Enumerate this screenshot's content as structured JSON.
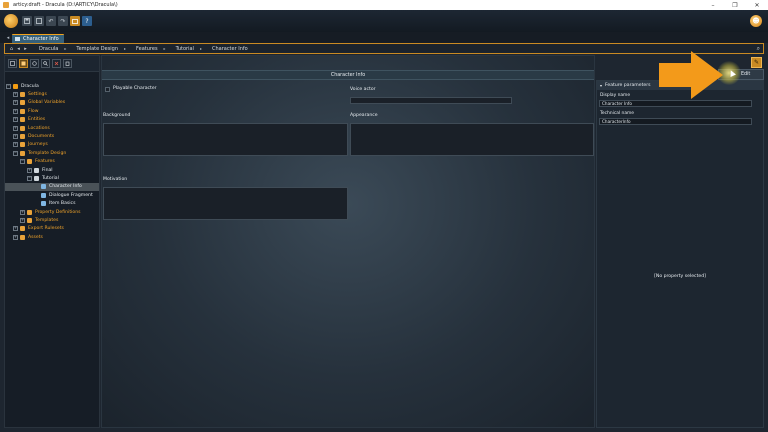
{
  "window": {
    "title": "articy:draft - Dracula (D:\\ARTICY\\Dracula\\)",
    "minimize": "–",
    "maximize": "❐",
    "close": "✕"
  },
  "toolbar": {
    "undo_glyph": "↶",
    "redo_glyph": "↷",
    "help_glyph": "?"
  },
  "tab": {
    "label": "Character Info",
    "scroll_left": "◂"
  },
  "breadcrumb": {
    "home_glyph": "⌂",
    "back_glyph": "◂",
    "forward_glyph": "▸",
    "items": [
      "Dracula",
      "Template Design",
      "Features",
      "Tutorial",
      "Character Info"
    ],
    "separator": "▸",
    "search_glyph": "⌕"
  },
  "tree": {
    "items": [
      {
        "label": "Dracula",
        "indent": 0,
        "color": "white",
        "expander": "−",
        "icon": "articy-logo-icon",
        "icon_color": "#f39c12"
      },
      {
        "label": "Settings",
        "indent": 1,
        "color": "orange",
        "expander": "+",
        "icon": "gear-icon",
        "icon_color": "#e8a23a"
      },
      {
        "label": "Global Variables",
        "indent": 1,
        "color": "orange",
        "expander": "+",
        "icon": "variables-icon",
        "icon_color": "#e8a23a"
      },
      {
        "label": "Flow",
        "indent": 1,
        "color": "orange",
        "expander": "+",
        "icon": "flow-icon",
        "icon_color": "#e8a23a"
      },
      {
        "label": "Entities",
        "indent": 1,
        "color": "orange",
        "expander": "+",
        "icon": "entities-icon",
        "icon_color": "#e8a23a"
      },
      {
        "label": "Locations",
        "indent": 1,
        "color": "orange",
        "expander": "+",
        "icon": "locations-icon",
        "icon_color": "#e8a23a"
      },
      {
        "label": "Documents",
        "indent": 1,
        "color": "orange",
        "expander": "+",
        "icon": "documents-icon",
        "icon_color": "#e8a23a"
      },
      {
        "label": "Journeys",
        "indent": 1,
        "color": "orange",
        "expander": "+",
        "icon": "journeys-icon",
        "icon_color": "#e8a23a"
      },
      {
        "label": "Template Design",
        "indent": 1,
        "color": "orange",
        "expander": "−",
        "icon": "template-design-icon",
        "icon_color": "#e8a23a"
      },
      {
        "label": "Features",
        "indent": 2,
        "color": "orange",
        "expander": "−",
        "icon": "folder-icon",
        "icon_color": "#e8a23a"
      },
      {
        "label": "Final",
        "indent": 3,
        "color": "white",
        "expander": "+",
        "icon": "folder-icon",
        "icon_color": "#cfd6dc"
      },
      {
        "label": "Tutorial",
        "indent": 3,
        "color": "white",
        "expander": "−",
        "icon": "folder-icon",
        "icon_color": "#cfd6dc"
      },
      {
        "label": "Character Info",
        "indent": 4,
        "color": "white",
        "expander": "",
        "icon": "feature-icon",
        "icon_color": "#7fb6e3",
        "selected": true
      },
      {
        "label": "Dialogue Fragment",
        "indent": 4,
        "color": "white",
        "expander": "",
        "icon": "feature-icon",
        "icon_color": "#7fb6e3"
      },
      {
        "label": "Item Basics",
        "indent": 4,
        "color": "white",
        "expander": "",
        "icon": "feature-icon",
        "icon_color": "#7fb6e3"
      },
      {
        "label": "Property Definitions",
        "indent": 2,
        "color": "orange",
        "expander": "+",
        "icon": "folder-icon",
        "icon_color": "#e8a23a"
      },
      {
        "label": "Templates",
        "indent": 2,
        "color": "orange",
        "expander": "+",
        "icon": "folder-icon",
        "icon_color": "#e8a23a"
      },
      {
        "label": "Export Rulesets",
        "indent": 1,
        "color": "orange",
        "expander": "+",
        "icon": "export-icon",
        "icon_color": "#e8a23a"
      },
      {
        "label": "Assets",
        "indent": 1,
        "color": "orange",
        "expander": "+",
        "icon": "assets-icon",
        "icon_color": "#e8a23a"
      }
    ]
  },
  "feature": {
    "header": "Character Info",
    "fields": {
      "playable_character": "Playable Character",
      "voice_actor": "Voice actor",
      "background": "Background",
      "appearance": "Appearance",
      "motivation": "Motivation"
    }
  },
  "right_panel": {
    "header": "Feature parameters",
    "collapse_glyph": "▾",
    "display_name_label": "Display name",
    "display_name_value": "Character Info",
    "technical_name_label": "Technical name",
    "technical_name_value": "CharacterInfo",
    "empty_text": "[No property selected]"
  },
  "edit_button": {
    "label": "Edit"
  },
  "colors": {
    "accent": "#c98a23",
    "tutorial_arrow": "#f39a1a",
    "tree_orange": "#f0a32a"
  }
}
